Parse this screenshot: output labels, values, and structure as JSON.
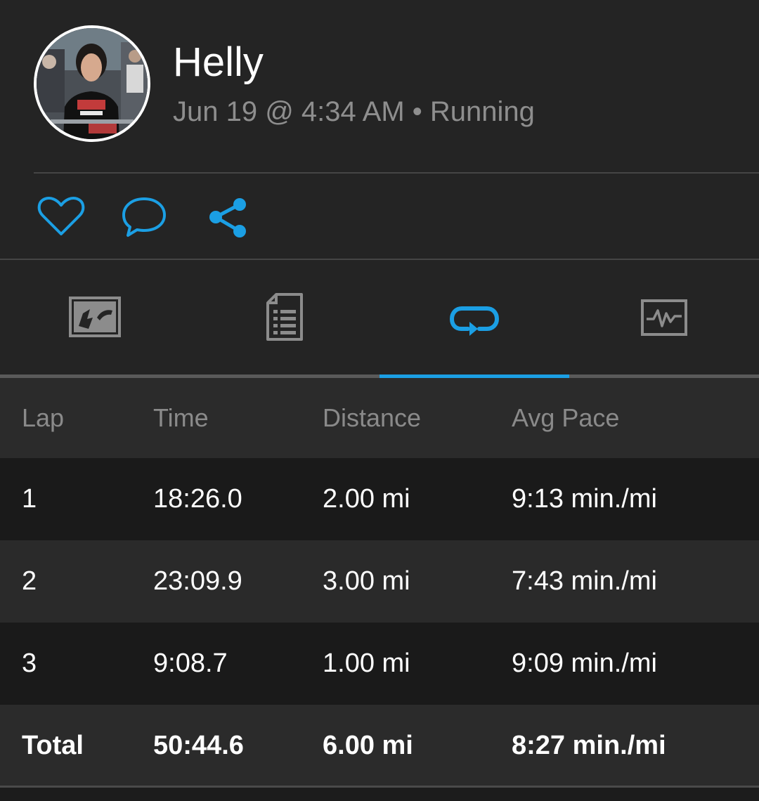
{
  "header": {
    "username": "Helly",
    "meta": "Jun 19 @ 4:34 AM • Running",
    "avatar_icon": "profile-photo"
  },
  "actions": [
    {
      "name": "like",
      "icon": "heart-icon"
    },
    {
      "name": "comment",
      "icon": "chat-bubble-icon"
    },
    {
      "name": "share",
      "icon": "share-icon"
    }
  ],
  "tabs": [
    {
      "name": "map",
      "icon": "map-icon",
      "active": false
    },
    {
      "name": "stats",
      "icon": "document-list-icon",
      "active": false
    },
    {
      "name": "laps",
      "icon": "laps-loop-icon",
      "active": true
    },
    {
      "name": "charts",
      "icon": "activity-chart-icon",
      "active": false
    }
  ],
  "laps_table": {
    "headers": [
      "Lap",
      "Time",
      "Distance",
      "Avg Pace"
    ],
    "rows": [
      [
        "1",
        "18:26.0",
        "2.00 mi",
        "9:13 min./mi"
      ],
      [
        "2",
        "23:09.9",
        "3.00 mi",
        "7:43 min./mi"
      ],
      [
        "3",
        "9:08.7",
        "1.00 mi",
        "9:09 min./mi"
      ]
    ],
    "total": [
      "Total",
      "50:44.6",
      "6.00 mi",
      "8:27 min./mi"
    ]
  },
  "colors": {
    "accent": "#1b9fe4",
    "background": "#242424",
    "icon_gray": "#8c8c8c",
    "muted_text": "#8e8e8e"
  }
}
